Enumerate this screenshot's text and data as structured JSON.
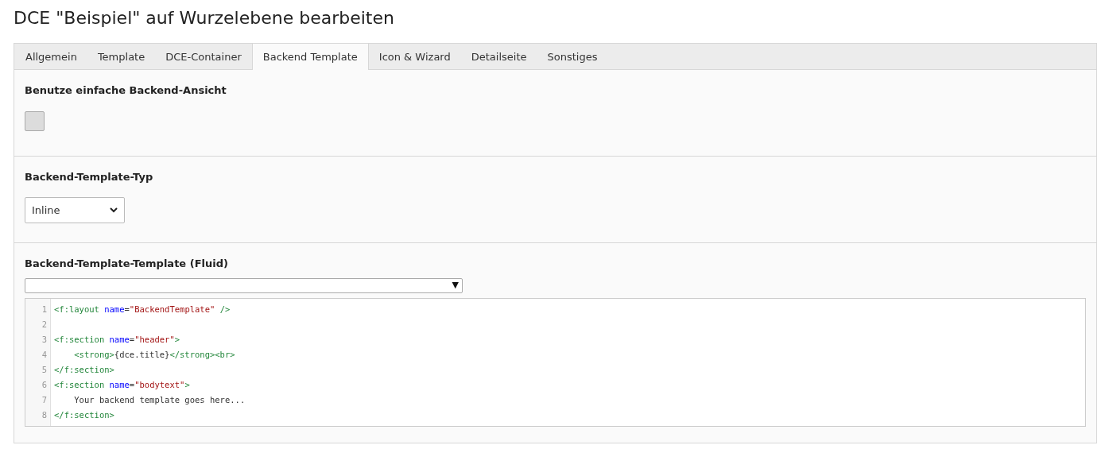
{
  "page_title": "DCE \"Beispiel\" auf Wurzelebene bearbeiten",
  "tabs": [
    {
      "label": "Allgemein",
      "selected": false
    },
    {
      "label": "Template",
      "selected": false
    },
    {
      "label": "DCE-Container",
      "selected": false
    },
    {
      "label": "Backend Template",
      "selected": true
    },
    {
      "label": "Icon & Wizard",
      "selected": false
    },
    {
      "label": "Detailseite",
      "selected": false
    },
    {
      "label": "Sonstiges",
      "selected": false
    }
  ],
  "sections": [
    {
      "kind": "checkbox",
      "label": "Benutze einfache Backend-Ansicht",
      "checked": false
    },
    {
      "kind": "select",
      "label": "Backend-Template-Typ",
      "value": "Inline"
    },
    {
      "kind": "code",
      "label": "Backend-Template-Template (Fluid)",
      "picker_arrow": "▼",
      "lines": [
        {
          "number": "1",
          "tokens": [
            {
              "kind": "tag",
              "text": "<f:layout "
            },
            {
              "kind": "attr",
              "text": "name"
            },
            {
              "kind": "text",
              "text": "="
            },
            {
              "kind": "string",
              "text": "\"BackendTemplate\""
            },
            {
              "kind": "tag",
              "text": " />"
            }
          ]
        },
        {
          "number": "2"
        },
        {
          "number": "3",
          "tokens": [
            {
              "kind": "tag",
              "text": "<f:section "
            },
            {
              "kind": "attr",
              "text": "name"
            },
            {
              "kind": "text",
              "text": "="
            },
            {
              "kind": "string",
              "text": "\"header\""
            },
            {
              "kind": "tag",
              "text": ">"
            }
          ]
        },
        {
          "number": "4",
          "indent": true,
          "tokens": [
            {
              "kind": "tag",
              "text": "<strong>"
            },
            {
              "kind": "text",
              "text": "{dce.title}"
            },
            {
              "kind": "tag",
              "text": "</strong><br>"
            }
          ]
        },
        {
          "number": "5",
          "tokens": [
            {
              "kind": "tag",
              "text": "</f:section>"
            }
          ]
        },
        {
          "number": "6",
          "tokens": [
            {
              "kind": "tag",
              "text": "<f:section "
            },
            {
              "kind": "attr",
              "text": "name"
            },
            {
              "kind": "text",
              "text": "="
            },
            {
              "kind": "string",
              "text": "\"bodytext\""
            },
            {
              "kind": "tag",
              "text": ">"
            }
          ]
        },
        {
          "number": "7",
          "indent": true,
          "tokens": [
            {
              "kind": "text",
              "text": "Your backend template goes here..."
            }
          ]
        },
        {
          "number": "8",
          "tokens": [
            {
              "kind": "tag",
              "text": "</f:section>"
            }
          ]
        }
      ]
    }
  ]
}
